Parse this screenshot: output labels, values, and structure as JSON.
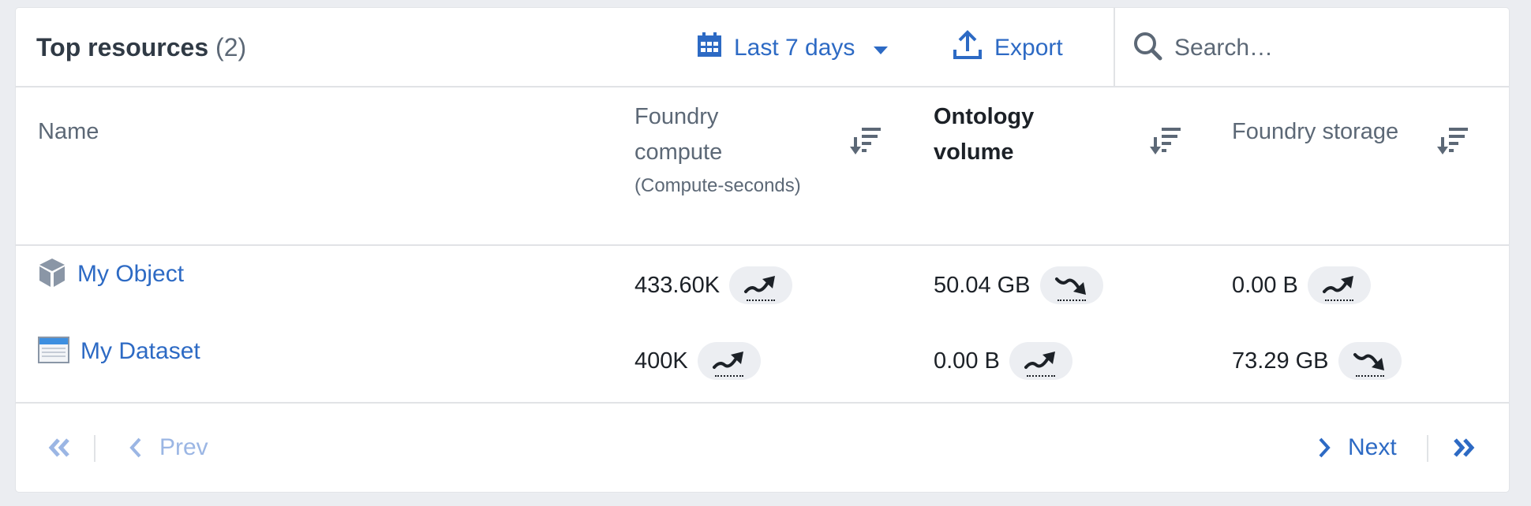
{
  "header": {
    "title": "Top resources",
    "count": "(2)",
    "date_range": {
      "label": "Last 7 days",
      "icon": "calendar-icon"
    },
    "export": {
      "label": "Export",
      "icon": "upload-icon"
    },
    "search": {
      "placeholder": "Search…",
      "value": "",
      "icon": "search-icon"
    }
  },
  "columns": [
    {
      "label": "Name"
    },
    {
      "label_line1": "Foundry",
      "label_line2": "compute",
      "sublabel": "(Compute-seconds)",
      "sort_icon": "sort-desc-icon"
    },
    {
      "label_line1": "Ontology",
      "label_line2": "volume",
      "sort_icon": "sort-desc-icon",
      "active": true
    },
    {
      "label": "Foundry storage",
      "sort_icon": "sort-desc-icon"
    }
  ],
  "rows": [
    {
      "name": "My Object",
      "icon": "object-cube-icon",
      "compute": {
        "value": "433.60K",
        "trend": "up"
      },
      "ontology": {
        "value": "50.04 GB",
        "trend": "down"
      },
      "storage": {
        "value": "0.00 B",
        "trend": "up"
      }
    },
    {
      "name": "My Dataset",
      "icon": "dataset-table-icon",
      "compute": {
        "value": "400K",
        "trend": "up"
      },
      "ontology": {
        "value": "0.00 B",
        "trend": "up"
      },
      "storage": {
        "value": "73.29 GB",
        "trend": "down"
      }
    }
  ],
  "pagination": {
    "first_icon": "double-chevron-left-icon",
    "prev_label": "Prev",
    "next_label": "Next",
    "last_icon": "double-chevron-right-icon",
    "prev_enabled": false,
    "next_enabled": true
  },
  "colors": {
    "accent": "#2d6ac4",
    "accent_disabled": "#9bb6e4",
    "text_primary": "#1c2127",
    "text_muted": "#5c6876",
    "background": "#ebedf1",
    "pill": "#eceef2"
  }
}
